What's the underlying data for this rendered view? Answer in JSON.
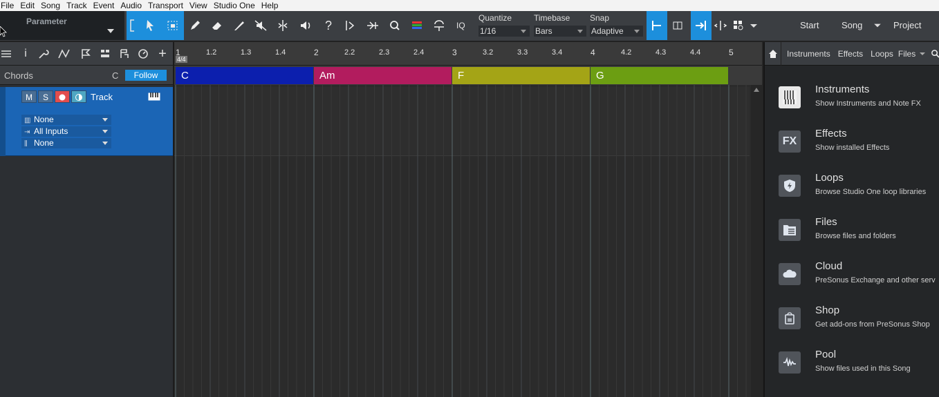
{
  "menu": [
    "File",
    "Edit",
    "Song",
    "Track",
    "Event",
    "Audio",
    "Transport",
    "View",
    "Studio One",
    "Help"
  ],
  "toolbar": {
    "parameter_label": "Parameter",
    "iq_label": "IQ",
    "quantize": {
      "label": "Quantize",
      "value": "1/16"
    },
    "timebase": {
      "label": "Timebase",
      "value": "Bars"
    },
    "snap": {
      "label": "Snap",
      "value": "Adaptive"
    },
    "start_label": "Start",
    "song_label": "Song",
    "project_label": "Project"
  },
  "chords_row": {
    "label": "Chords",
    "key": "C",
    "follow_label": "Follow"
  },
  "track": {
    "mute_label": "M",
    "solo_label": "S",
    "name": "Track",
    "dropdowns": [
      "None",
      "All Inputs",
      "None"
    ]
  },
  "ruler": {
    "signature": "4/4",
    "ticks": [
      "1",
      "1.2",
      "1.3",
      "1.4",
      "2",
      "2.2",
      "2.3",
      "2.4",
      "3",
      "3.2",
      "3.3",
      "3.4",
      "4",
      "4.2",
      "4.3",
      "4.4",
      "5"
    ]
  },
  "chords": [
    {
      "name": "C",
      "color": "#0c1fae"
    },
    {
      "name": "Am",
      "color": "#b21c5e"
    },
    {
      "name": "F",
      "color": "#a4a416"
    },
    {
      "name": "G",
      "color": "#6c9e12"
    }
  ],
  "browser": {
    "tabs": [
      "Instruments",
      "Effects",
      "Loops",
      "Files"
    ],
    "items": [
      {
        "title": "Instruments",
        "subtitle": "Show Instruments and Note FX",
        "icon": "piano-icon"
      },
      {
        "title": "Effects",
        "subtitle": "Show installed Effects",
        "icon": "fx-icon",
        "glyph": "FX"
      },
      {
        "title": "Loops",
        "subtitle": "Browse Studio One loop libraries",
        "icon": "loops-icon"
      },
      {
        "title": "Files",
        "subtitle": "Browse files and folders",
        "icon": "files-icon"
      },
      {
        "title": "Cloud",
        "subtitle": "PreSonus Exchange and other serv",
        "icon": "cloud-icon"
      },
      {
        "title": "Shop",
        "subtitle": "Get add-ons from PreSonus Shop",
        "icon": "shop-icon"
      },
      {
        "title": "Pool",
        "subtitle": "Show files used in this Song",
        "icon": "pool-icon"
      }
    ]
  }
}
